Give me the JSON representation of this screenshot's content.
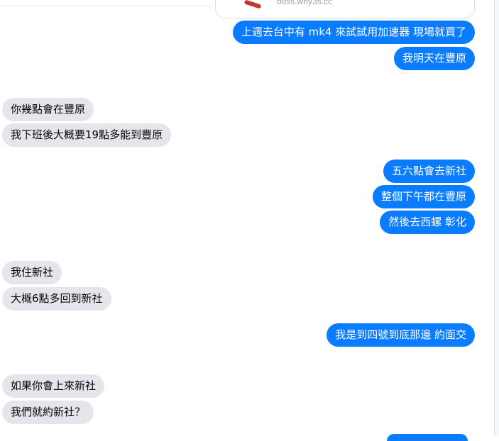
{
  "link_preview": {
    "url": "boss.why3s.cc"
  },
  "messages": [
    {
      "side": "out",
      "text": "上週去台中有 mk4 來試試用加速器 現場就買了"
    },
    {
      "side": "out",
      "text": "我明天在豐原"
    },
    {
      "side": "in",
      "text": "你幾點會在豐原"
    },
    {
      "side": "in",
      "text": "我下班後大概要19點多能到豐原"
    },
    {
      "side": "out",
      "text": "五六點會去新社"
    },
    {
      "side": "out",
      "text": "整個下午都在豐原"
    },
    {
      "side": "out",
      "text": "然後去西螺 彰化"
    },
    {
      "side": "in",
      "text": "我住新社"
    },
    {
      "side": "in",
      "text": "大概6點多回到新社"
    },
    {
      "side": "out",
      "text": "我是到四號到底那邊 約面交"
    },
    {
      "side": "in",
      "text": "如果你會上來新社"
    },
    {
      "side": "in",
      "text": "我們就約新社？"
    }
  ],
  "colors": {
    "outgoing": "#0a7cff",
    "incoming": "#e4e6eb",
    "link_card_border": "#dddfe2"
  }
}
